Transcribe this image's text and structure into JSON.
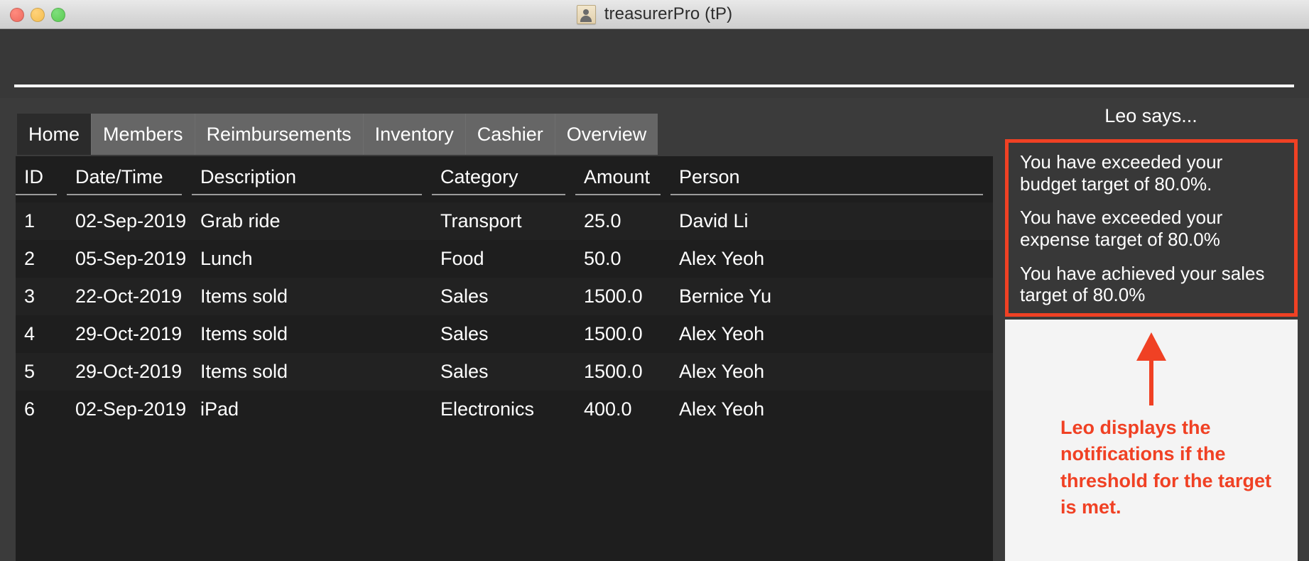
{
  "window": {
    "title": "treasurerPro (tP)",
    "icon": "person-card-icon",
    "controls": {
      "close_label": "close",
      "minimize_label": "minimize",
      "maximize_label": "maximize"
    }
  },
  "tabs": [
    {
      "label": "Home",
      "active": true
    },
    {
      "label": "Members",
      "active": false
    },
    {
      "label": "Reimbursements",
      "active": false
    },
    {
      "label": "Inventory",
      "active": false
    },
    {
      "label": "Cashier",
      "active": false
    },
    {
      "label": "Overview",
      "active": false
    }
  ],
  "table": {
    "columns": [
      "ID",
      "Date/Time",
      "Description",
      "Category",
      "Amount",
      "Person"
    ],
    "rows": [
      [
        "1",
        "02-Sep-2019",
        "Grab ride",
        "Transport",
        "25.0",
        "David Li"
      ],
      [
        "2",
        "05-Sep-2019",
        "Lunch",
        "Food",
        "50.0",
        "Alex Yeoh"
      ],
      [
        "3",
        "22-Oct-2019",
        "Items sold",
        "Sales",
        "1500.0",
        "Bernice Yu"
      ],
      [
        "4",
        "29-Oct-2019",
        "Items sold",
        "Sales",
        "1500.0",
        "Alex Yeoh"
      ],
      [
        "5",
        "29-Oct-2019",
        "Items sold",
        "Sales",
        "1500.0",
        "Alex Yeoh"
      ],
      [
        "6",
        "02-Sep-2019",
        "iPad",
        "Electronics",
        "400.0",
        "Alex Yeoh"
      ]
    ]
  },
  "sidebar": {
    "heading": "Leo says...",
    "notifications": [
      "You have exceeded your budget target of 80.0%.",
      "You have exceeded your expense target of 80.0%",
      "You have achieved your sales target of 80.0%"
    ]
  },
  "annotation": {
    "arrow": "up-arrow-icon",
    "text": "Leo displays the notifications if the threshold for the target is met."
  },
  "colors": {
    "accent_red": "#f04124",
    "window_chrome": "#3b3b3b",
    "table_bg": "#1e1e1e",
    "tabbar_bg": "#666666",
    "active_tab_bg": "#2b2b2b",
    "callout_bg": "#f4f4f4"
  }
}
